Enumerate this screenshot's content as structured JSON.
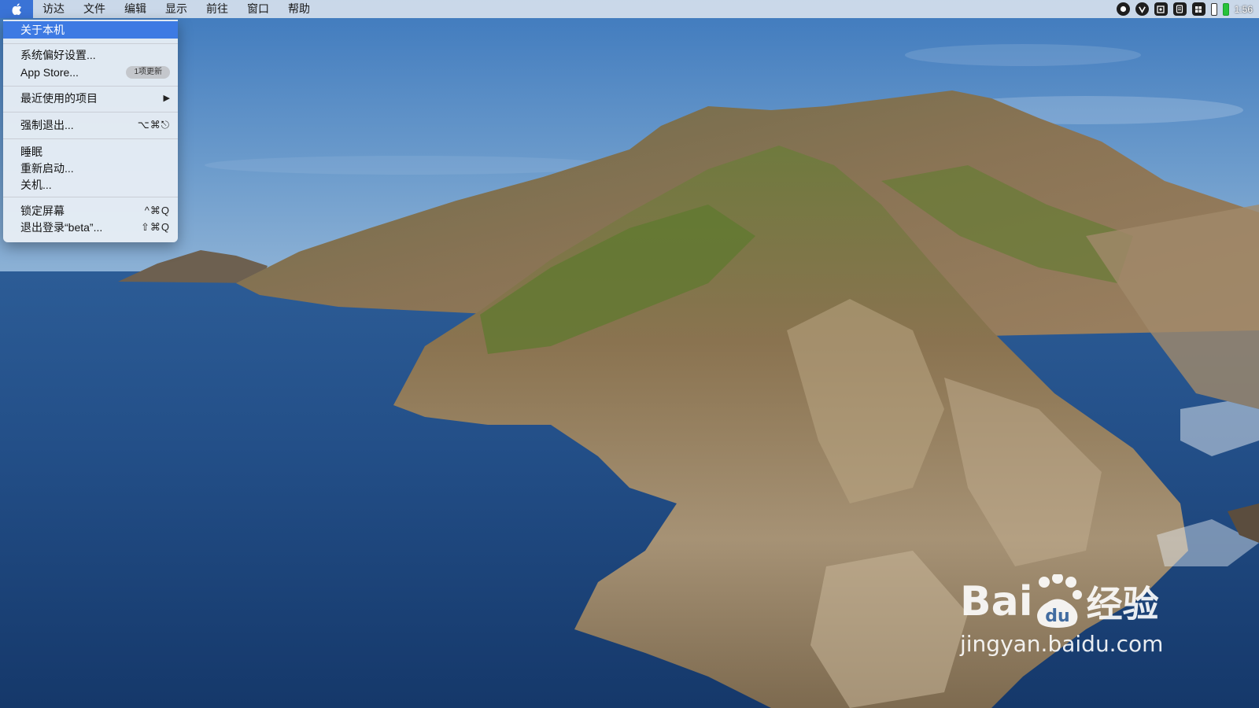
{
  "menubar": {
    "apple_icon": "apple-logo-icon",
    "items": [
      "访达",
      "文件",
      "编辑",
      "显示",
      "前往",
      "窗口",
      "帮助"
    ],
    "status_icons": [
      "record-icon",
      "vpn-icon",
      "screen-capture-icon",
      "notes-icon",
      "grid-icon",
      "battery-icon",
      "battery-charging-icon"
    ],
    "clock": "1:56"
  },
  "apple_menu": {
    "about": "关于本机",
    "system_prefs": "系统偏好设置...",
    "app_store": "App Store...",
    "app_store_badge": "1项更新",
    "recent_items": "最近使用的项目",
    "force_quit": "强制退出...",
    "force_quit_shortcut": "⌥⌘⎋",
    "sleep": "睡眠",
    "restart": "重新启动...",
    "shutdown": "关机...",
    "lock_screen": "锁定屏幕",
    "lock_screen_shortcut": "^⌘Q",
    "logout": "退出登录“beta”...",
    "logout_shortcut": "⇧⌘Q"
  },
  "watermark": {
    "brand": "Bai",
    "brand_cn": "经验",
    "url": "jingyan.baidu.com"
  },
  "colors": {
    "highlight": "#3d7ae3",
    "sky": "#5b8cc4",
    "sea": "#1f477f"
  }
}
